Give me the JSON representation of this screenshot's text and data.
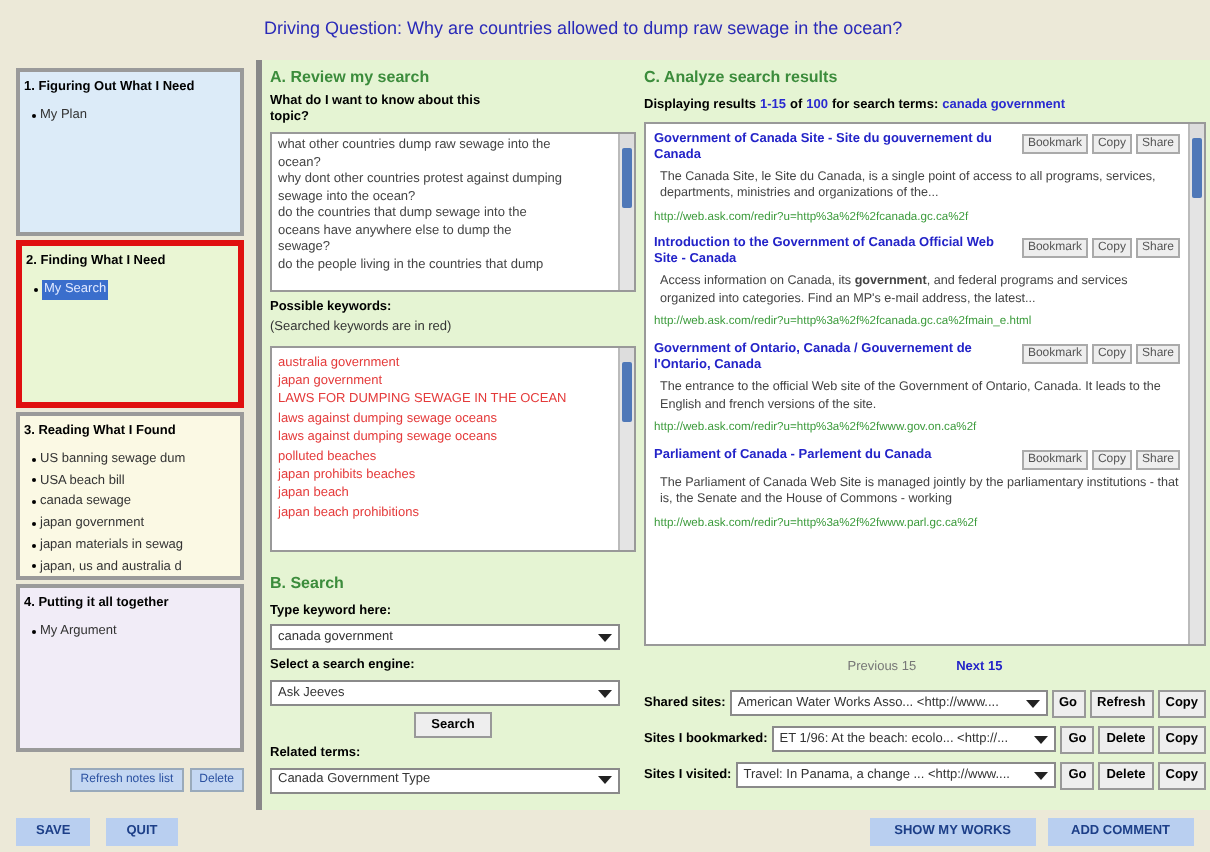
{
  "driving_question": "Driving Question: Why are countries allowed to dump raw sewage in the ocean?",
  "stages": [
    {
      "title": "1. Figuring Out What I Need",
      "selected": false,
      "color": "#dcebf8",
      "items": [
        {
          "label": "My Plan",
          "selected": false
        }
      ]
    },
    {
      "title": "2. Finding What I Need",
      "selected": true,
      "color": "#eaf6d4",
      "items": [
        {
          "label": "My Search",
          "selected": true
        }
      ]
    },
    {
      "title": "3. Reading What I Found",
      "selected": false,
      "color": "#fbf9e4",
      "items": [
        {
          "label": "US banning sewage dum",
          "selected": false
        },
        {
          "label": "USA beach bill",
          "selected": false
        },
        {
          "label": "canada sewage",
          "selected": false
        },
        {
          "label": "japan government",
          "selected": false
        },
        {
          "label": "japan materials in sewag",
          "selected": false
        },
        {
          "label": "japan, us and australia d",
          "selected": false
        }
      ]
    },
    {
      "title": "4. Putting it all together",
      "selected": false,
      "color": "#f1ecf7",
      "items": [
        {
          "label": "My Argument",
          "selected": false
        }
      ]
    }
  ],
  "notes_buttons": [
    "Refresh notes list",
    "Delete"
  ],
  "review": {
    "heading": "A.  Review my search",
    "question_label": "What do I want to know about this topic?",
    "questions": [
      "what other countries dump raw sewage into the",
      "ocean?",
      "why dont other countries protest against dumping",
      "sewage into the ocean?",
      "do the countries that dump sewage into the",
      "oceans have anywhere else to dump the",
      "sewage?",
      "do the people living in the countries that dump"
    ],
    "keywords_label": "Possible keywords:",
    "keywords_hint": "(Searched keywords are in red)",
    "keywords": [
      {
        "text": "australia government",
        "searched": true
      },
      {
        "text": "japan government",
        "searched": true
      },
      {
        "text": "LAWS FOR DUMPING SEWAGE IN THE OCEAN",
        "searched": true
      },
      {
        "text": "laws against dumping sewage oceans",
        "searched": true
      },
      {
        "text": "laws against dumping sewage  oceans",
        "searched": true
      },
      {
        "text": "polluted beaches",
        "searched": true
      },
      {
        "text": "japan prohibits beaches",
        "searched": true
      },
      {
        "text": "japan beach",
        "searched": true
      },
      {
        "text": "japan beach prohibitions",
        "searched": true
      }
    ]
  },
  "search": {
    "heading": "B.  Search",
    "keyword_label": "Type keyword here:",
    "keyword_value": "canada government",
    "engine_label": "Select a search engine:",
    "engine_value": "Ask Jeeves",
    "button": "Search",
    "related_label": "Related terms:",
    "related_value": "Canada Government Type"
  },
  "results": {
    "heading": "C.  Analyze search results",
    "summary": [
      {
        "kind": "plain",
        "text": "Displaying results"
      },
      {
        "kind": "highlight",
        "text": "1-15"
      },
      {
        "kind": "plain",
        "text": "of"
      },
      {
        "kind": "highlight",
        "text": "100"
      },
      {
        "kind": "plain",
        "text": "for search terms:"
      },
      {
        "kind": "highlight",
        "text": "canada government"
      }
    ],
    "items": [
      {
        "title": "Government of Canada Site - Site du gouvernement du Canada",
        "snippet": "The Canada Site, le Site du Canada, is a single point of access to all programs, services, departments, ministries and organizations of the...",
        "url": "http://web.ask.com/redir?u=http%3a%2f%2fcanada.gc.ca%2f",
        "actions": [
          "Bookmark",
          "Copy",
          "Share"
        ]
      },
      {
        "title": "Introduction to the Government of Canada Official Web Site - Canada",
        "snippet": "Access information on Canada, its **government**, and federal programs and services organized into categories. Find an MP's e-mail address, the latest...",
        "url": "http://web.ask.com/redir?u=http%3a%2f%2fcanada.gc.ca%2fmain_e.html",
        "actions": [
          "Bookmark",
          "Copy",
          "Share"
        ]
      },
      {
        "title": "Government of Ontario, Canada / Gouvernement de l'Ontario, Canada",
        "snippet": "The entrance to the official Web site of the Government of Ontario, Canada. It leads to the English and french versions of the site.",
        "url": "http://web.ask.com/redir?u=http%3a%2f%2fwww.gov.on.ca%2f",
        "actions": [
          "Bookmark",
          "Copy",
          "Share"
        ]
      },
      {
        "title": "Parliament of Canada - Parlement du Canada",
        "snippet": "The Parliament of Canada Web Site is managed jointly by the parliamentary institutions - that is, the Senate and the House of Commons - working",
        "url": "http://web.ask.com/redir?u=http%3a%2f%2fwww.parl.gc.ca%2f",
        "actions": [
          "Bookmark",
          "Copy",
          "Share"
        ]
      }
    ],
    "previous": "Previous 15",
    "next": "Next 15"
  },
  "site_lists": [
    {
      "label": "Shared sites:",
      "value": "American Water Works Asso... <http://www....",
      "buttons": [
        "Go",
        "Refresh",
        "Copy"
      ]
    },
    {
      "label": "Sites I bookmarked:",
      "value": "ET 1/96: At the beach: ecolo... <http://...",
      "buttons": [
        "Go",
        "Delete",
        "Copy"
      ]
    },
    {
      "label": "Sites I visited:",
      "value": "Travel: In Panama, a change ... <http://www....",
      "buttons": [
        "Go",
        "Delete",
        "Copy"
      ]
    }
  ],
  "footer_left": [
    "SAVE",
    "QUIT"
  ],
  "footer_right": [
    "SHOW MY WORKS",
    "ADD COMMENT"
  ]
}
